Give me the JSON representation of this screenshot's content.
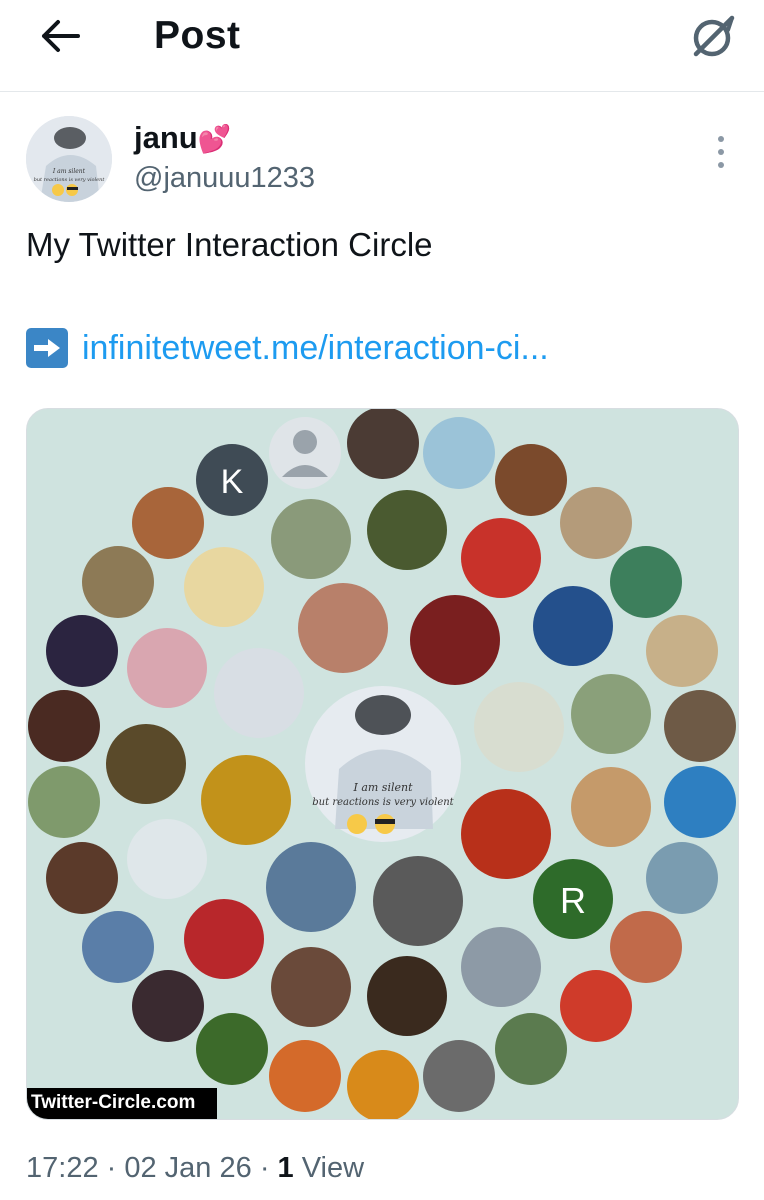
{
  "header": {
    "title": "Post"
  },
  "post": {
    "author_name": "janu",
    "author_emoji": "💕",
    "author_handle": "@januuu1233",
    "avatar_caption_1": "I am silent",
    "avatar_caption_2": "but reactions is very violent",
    "text": "My Twitter Interaction Circle",
    "link_icon": "➡️",
    "link_text": "infinitetweet.me/interaction-ci..."
  },
  "media": {
    "watermark": "Twitter-Circle.com",
    "center_caption_1": "I am silent",
    "center_caption_2": "but reactions is very violent",
    "letter_avatars": [
      "K",
      "R"
    ]
  },
  "meta": {
    "time": "17:22",
    "date": "02 Jan 26",
    "views_count": "1",
    "views_label": "View"
  },
  "colors": {
    "link": "#1d9bf0",
    "secondary_text": "#536471",
    "media_bg": "#cfe3df",
    "avatar_k": "#3f4b55",
    "avatar_r": "#2e6b2a"
  },
  "icons": [
    "back-arrow-icon",
    "grok-icon",
    "more-vertical-icon",
    "arrow-right-emoji-icon"
  ]
}
